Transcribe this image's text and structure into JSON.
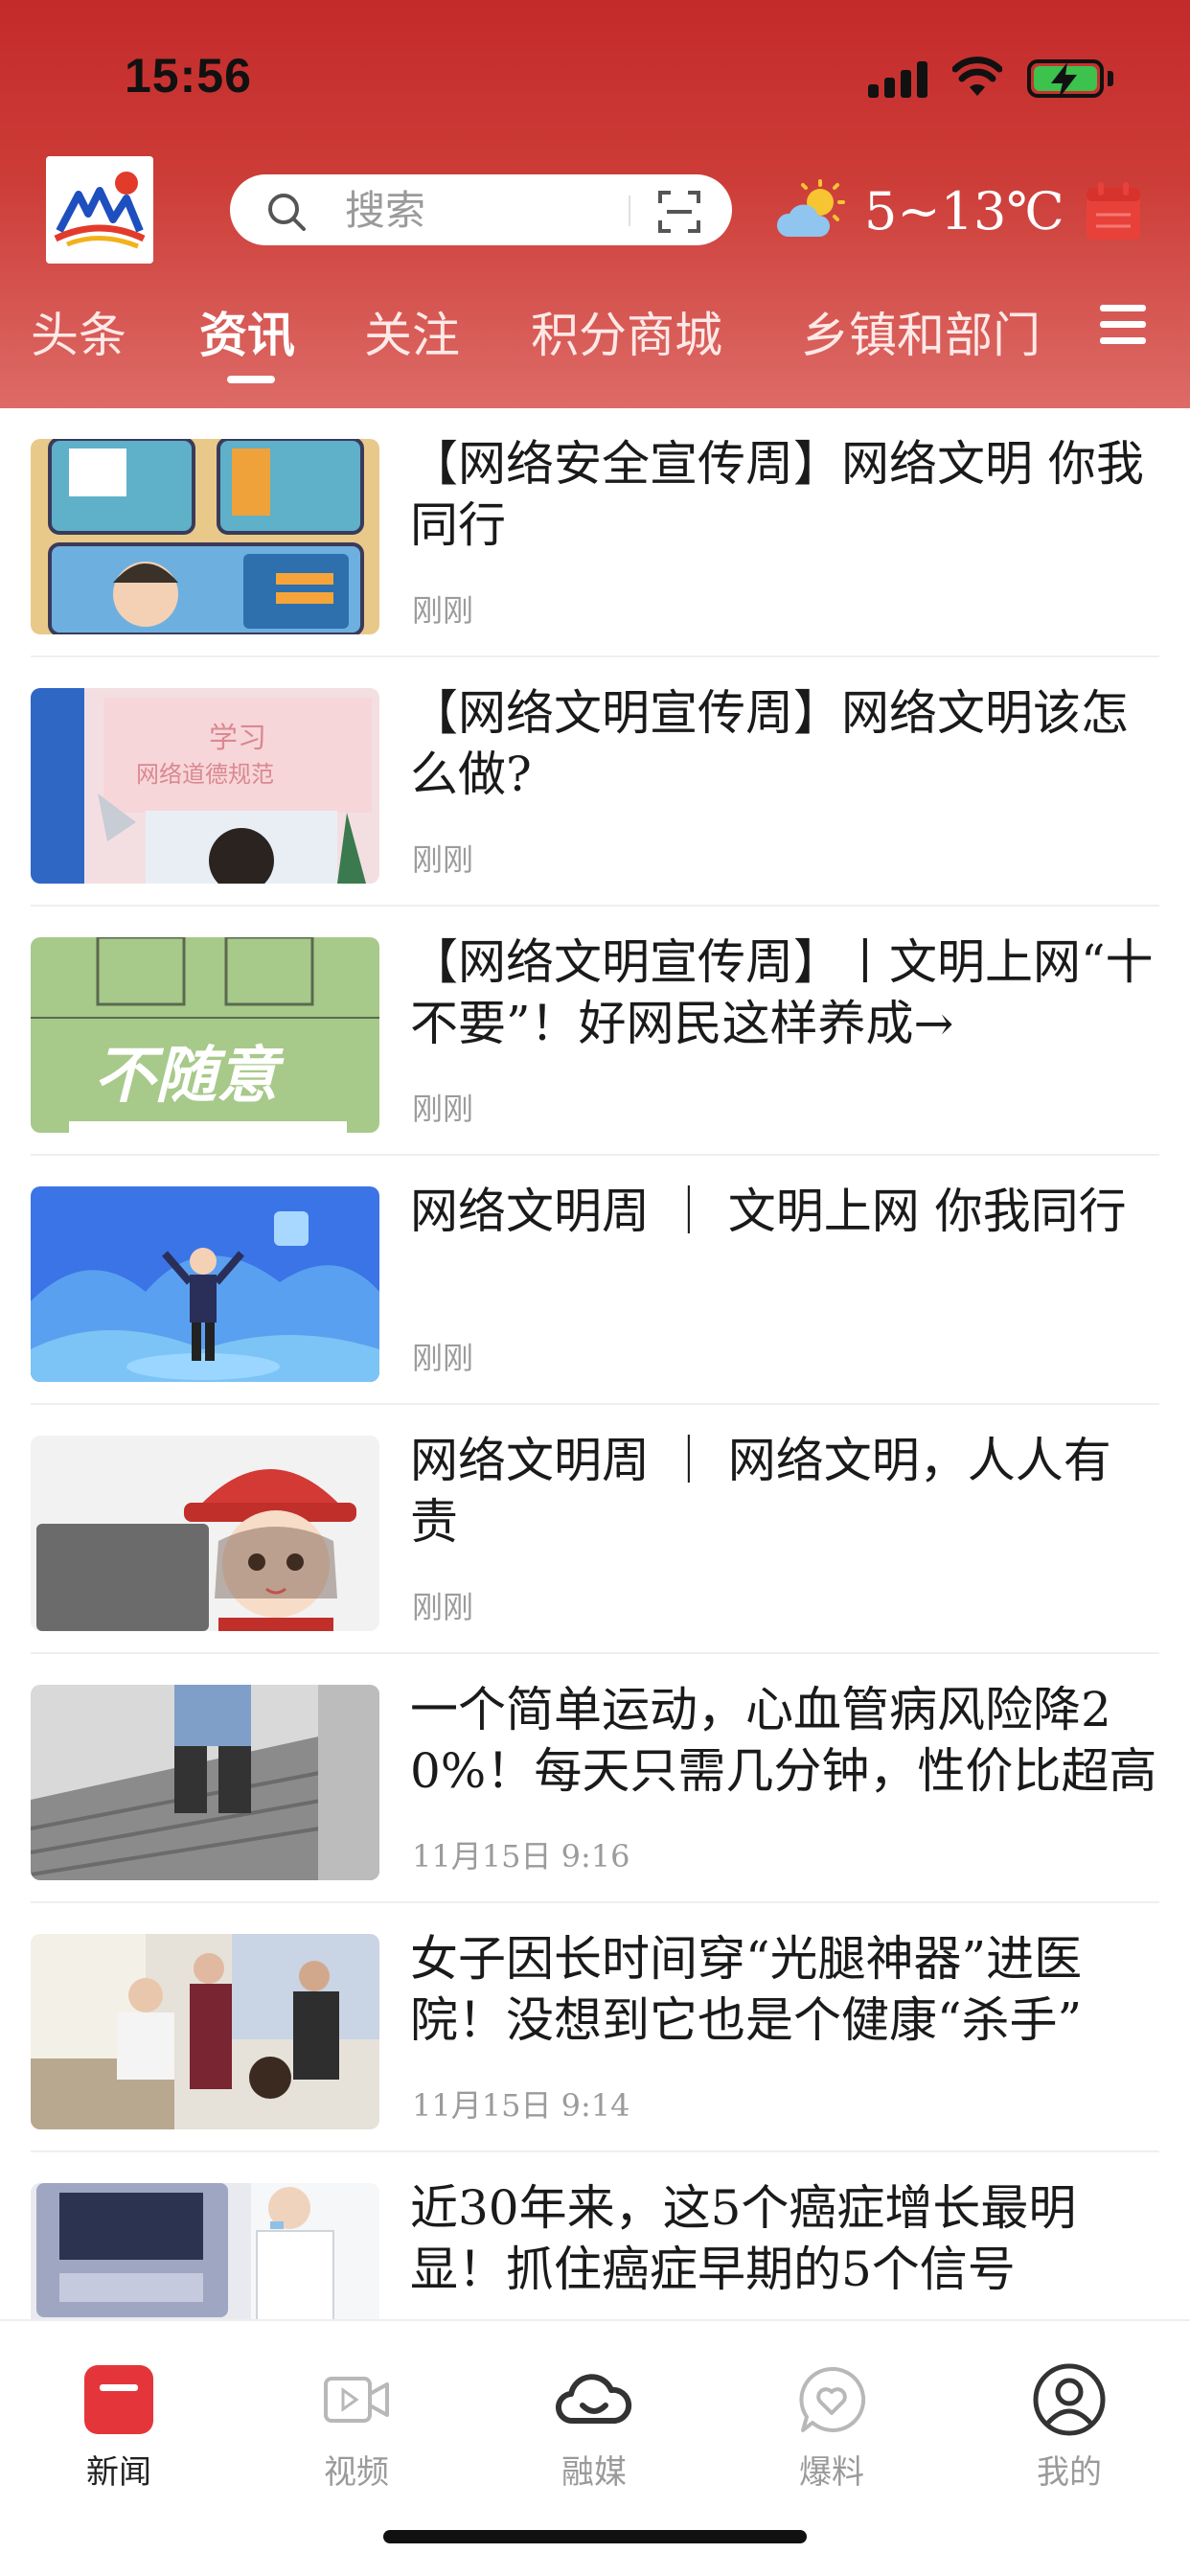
{
  "status_bar": {
    "time": "15:56"
  },
  "header": {
    "search": {
      "placeholder": "搜索"
    },
    "weather": {
      "temperature": "5~13℃",
      "icon": "partly-sunny-icon"
    },
    "tabs": [
      {
        "label": "头条",
        "active": false
      },
      {
        "label": "资讯",
        "active": true
      },
      {
        "label": "关注",
        "active": false
      },
      {
        "label": "积分商城",
        "active": false
      },
      {
        "label": "乡镇和部门",
        "active": false
      }
    ],
    "accent_color": "#c62d2b"
  },
  "news": [
    {
      "title": "【网络安全宣传周】网络文明 你我同行",
      "time": "刚刚"
    },
    {
      "title": "【网络文明宣传周】网络文明该怎么做?",
      "time": "刚刚",
      "thumb_text_1": "学习",
      "thumb_text_2": "网络道德规范"
    },
    {
      "title": "【网络文明宣传周】丨文明上网“十不要”！好网民这样养成→",
      "time": "刚刚",
      "thumb_text": "不随意"
    },
    {
      "title": "网络文明周 ｜ 文明上网 你我同行",
      "time": "刚刚"
    },
    {
      "title": "网络文明周 ｜ 网络文明，人人有责",
      "time": "刚刚"
    },
    {
      "title": "一个简单运动，心血管病风险降20%！每天只需几分钟，性价比超高",
      "time": "11月15日 9:16"
    },
    {
      "title": "女子因长时间穿“光腿神器”进医院！没想到它也是个健康“杀手”",
      "time": "11月15日 9:14"
    },
    {
      "title": "近30年来，这5个癌症增长最明显！抓住癌症早期的5个信号",
      "time": ""
    }
  ],
  "bottom_nav": [
    {
      "label": "新闻",
      "icon": "news-icon",
      "active": true
    },
    {
      "label": "视频",
      "icon": "video-icon",
      "active": false
    },
    {
      "label": "融媒",
      "icon": "cloud-icon",
      "active": false
    },
    {
      "label": "爆料",
      "icon": "heart-chat-icon",
      "active": false
    },
    {
      "label": "我的",
      "icon": "profile-icon",
      "active": false
    }
  ]
}
